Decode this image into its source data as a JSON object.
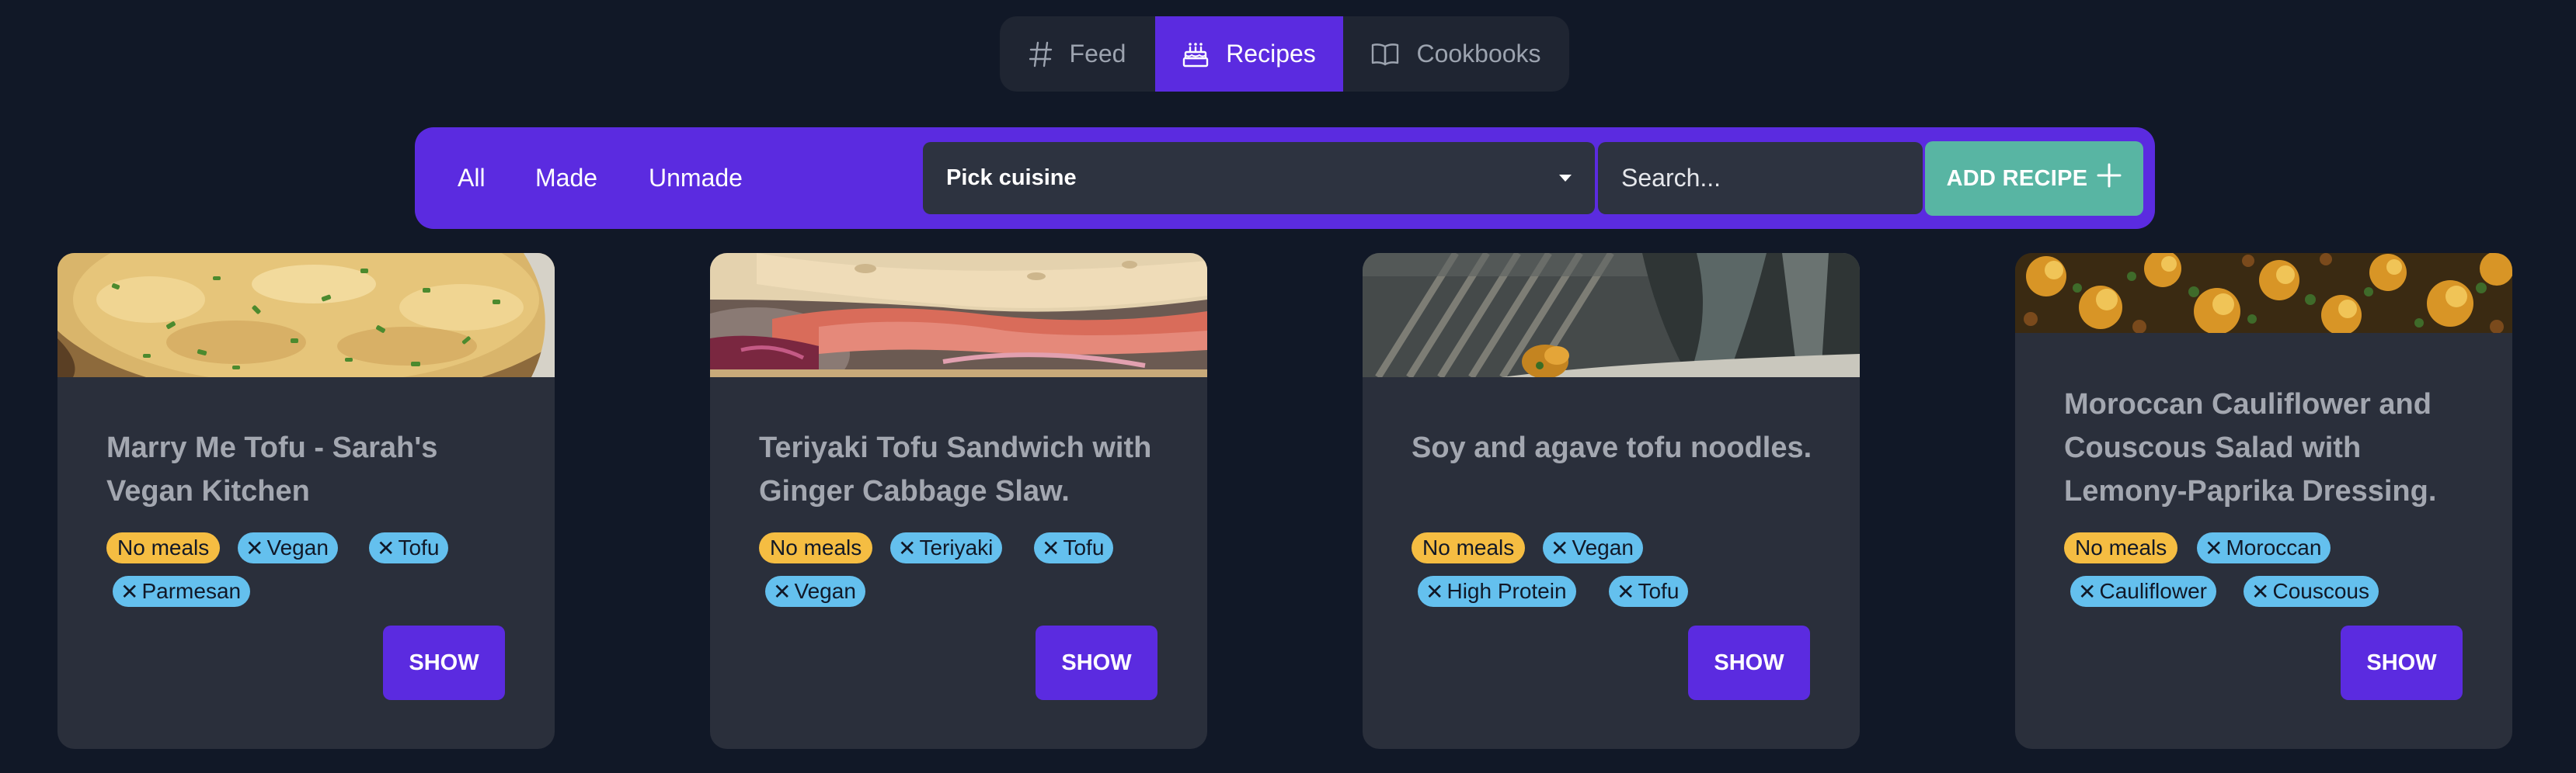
{
  "nav": {
    "tabs": [
      {
        "label": "Feed",
        "icon": "hash-icon"
      },
      {
        "label": "Recipes",
        "icon": "cake-icon"
      },
      {
        "label": "Cookbooks",
        "icon": "book-icon"
      }
    ],
    "active": "Recipes"
  },
  "filters": {
    "buttons": [
      "All",
      "Made",
      "Unmade"
    ],
    "cuisine_select": "Pick cuisine",
    "search_placeholder": "Search...",
    "add_recipe_label": "ADD RECIPE"
  },
  "recipes": [
    {
      "title": "Marry Me Tofu - Sarah's Vegan Kitchen",
      "meal_tag": "No meals",
      "tags": [
        "Vegan",
        "Tofu",
        "Parmesan"
      ],
      "show_label": "SHOW"
    },
    {
      "title": "Teriyaki Tofu Sandwich with Ginger Cabbage Slaw.",
      "meal_tag": "No meals",
      "tags": [
        "Teriyaki",
        "Tofu",
        "Vegan"
      ],
      "show_label": "SHOW"
    },
    {
      "title": "Soy and agave tofu noodles.",
      "meal_tag": "No meals",
      "tags": [
        "Vegan",
        "High Protein",
        "Tofu"
      ],
      "show_label": "SHOW"
    },
    {
      "title": "Moroccan Cauliflower and Couscous Salad with Lemony-Paprika Dressing.",
      "meal_tag": "No meals",
      "tags": [
        "Moroccan",
        "Cauliflower",
        "Couscous"
      ],
      "show_label": "SHOW"
    }
  ],
  "colors": {
    "background": "#111827",
    "accent": "#5b2be0",
    "card": "#2a2f3b",
    "teal": "#58b5a3",
    "meal_tag": "#f5bd42",
    "category_tag": "#64c0ee"
  }
}
